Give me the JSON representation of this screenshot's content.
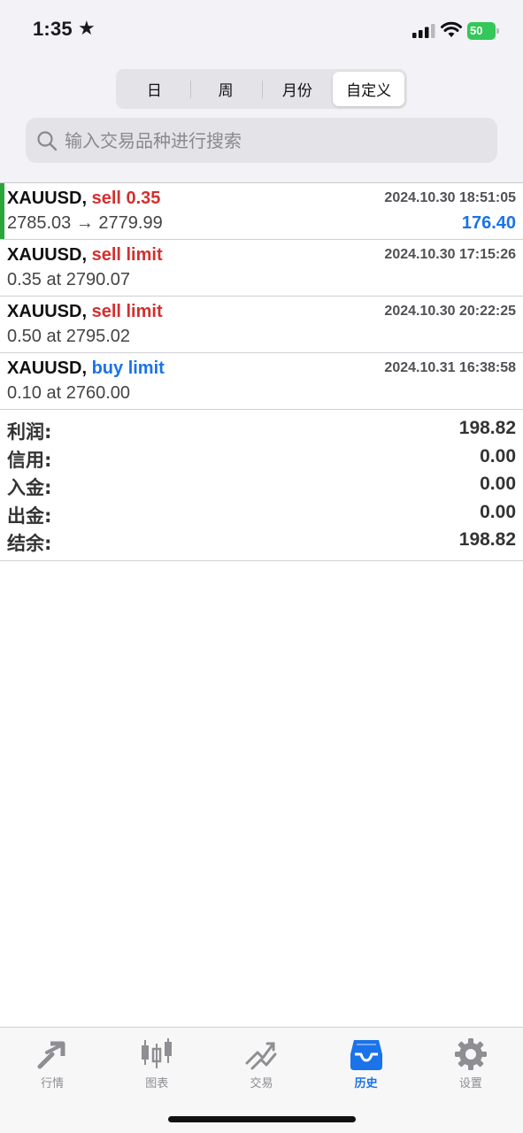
{
  "status_bar": {
    "time": "1:35",
    "battery": "50"
  },
  "segments": [
    {
      "label": "日"
    },
    {
      "label": "周"
    },
    {
      "label": "月份"
    },
    {
      "label": "自定义"
    }
  ],
  "search": {
    "placeholder": "输入交易品种进行搜索"
  },
  "orders": [
    {
      "symbol": "XAUUSD,",
      "type": "sell 0.35",
      "time": "2024.10.30 18:51:05",
      "detail": "2785.03 → 2779.99",
      "profit": "176.40"
    },
    {
      "symbol": "XAUUSD,",
      "type": "sell limit",
      "time": "2024.10.30 17:15:26",
      "detail": "0.35 at 2790.07",
      "profit": ""
    },
    {
      "symbol": "XAUUSD,",
      "type": "sell limit",
      "time": "2024.10.30 20:22:25",
      "detail": "0.50 at 2795.02",
      "profit": ""
    },
    {
      "symbol": "XAUUSD,",
      "type": "buy limit",
      "time": "2024.10.31 16:38:58",
      "detail": "0.10 at 2760.00",
      "profit": ""
    }
  ],
  "summary": [
    {
      "label": "利润:",
      "value": "198.82"
    },
    {
      "label": "信用:",
      "value": "0.00"
    },
    {
      "label": "入金:",
      "value": "0.00"
    },
    {
      "label": "出金:",
      "value": "0.00"
    },
    {
      "label": "结余:",
      "value": "198.82"
    }
  ],
  "tabs": [
    {
      "label": "行情",
      "icon": "quotes-icon"
    },
    {
      "label": "图表",
      "icon": "chart-icon"
    },
    {
      "label": "交易",
      "icon": "trade-icon"
    },
    {
      "label": "历史",
      "icon": "history-icon"
    },
    {
      "label": "设置",
      "icon": "settings-icon"
    }
  ],
  "colors": {
    "sell": "#d32f2f",
    "buy": "#1a73e8",
    "accent": "#1a73e8",
    "active_bar": "#2aa63b"
  }
}
